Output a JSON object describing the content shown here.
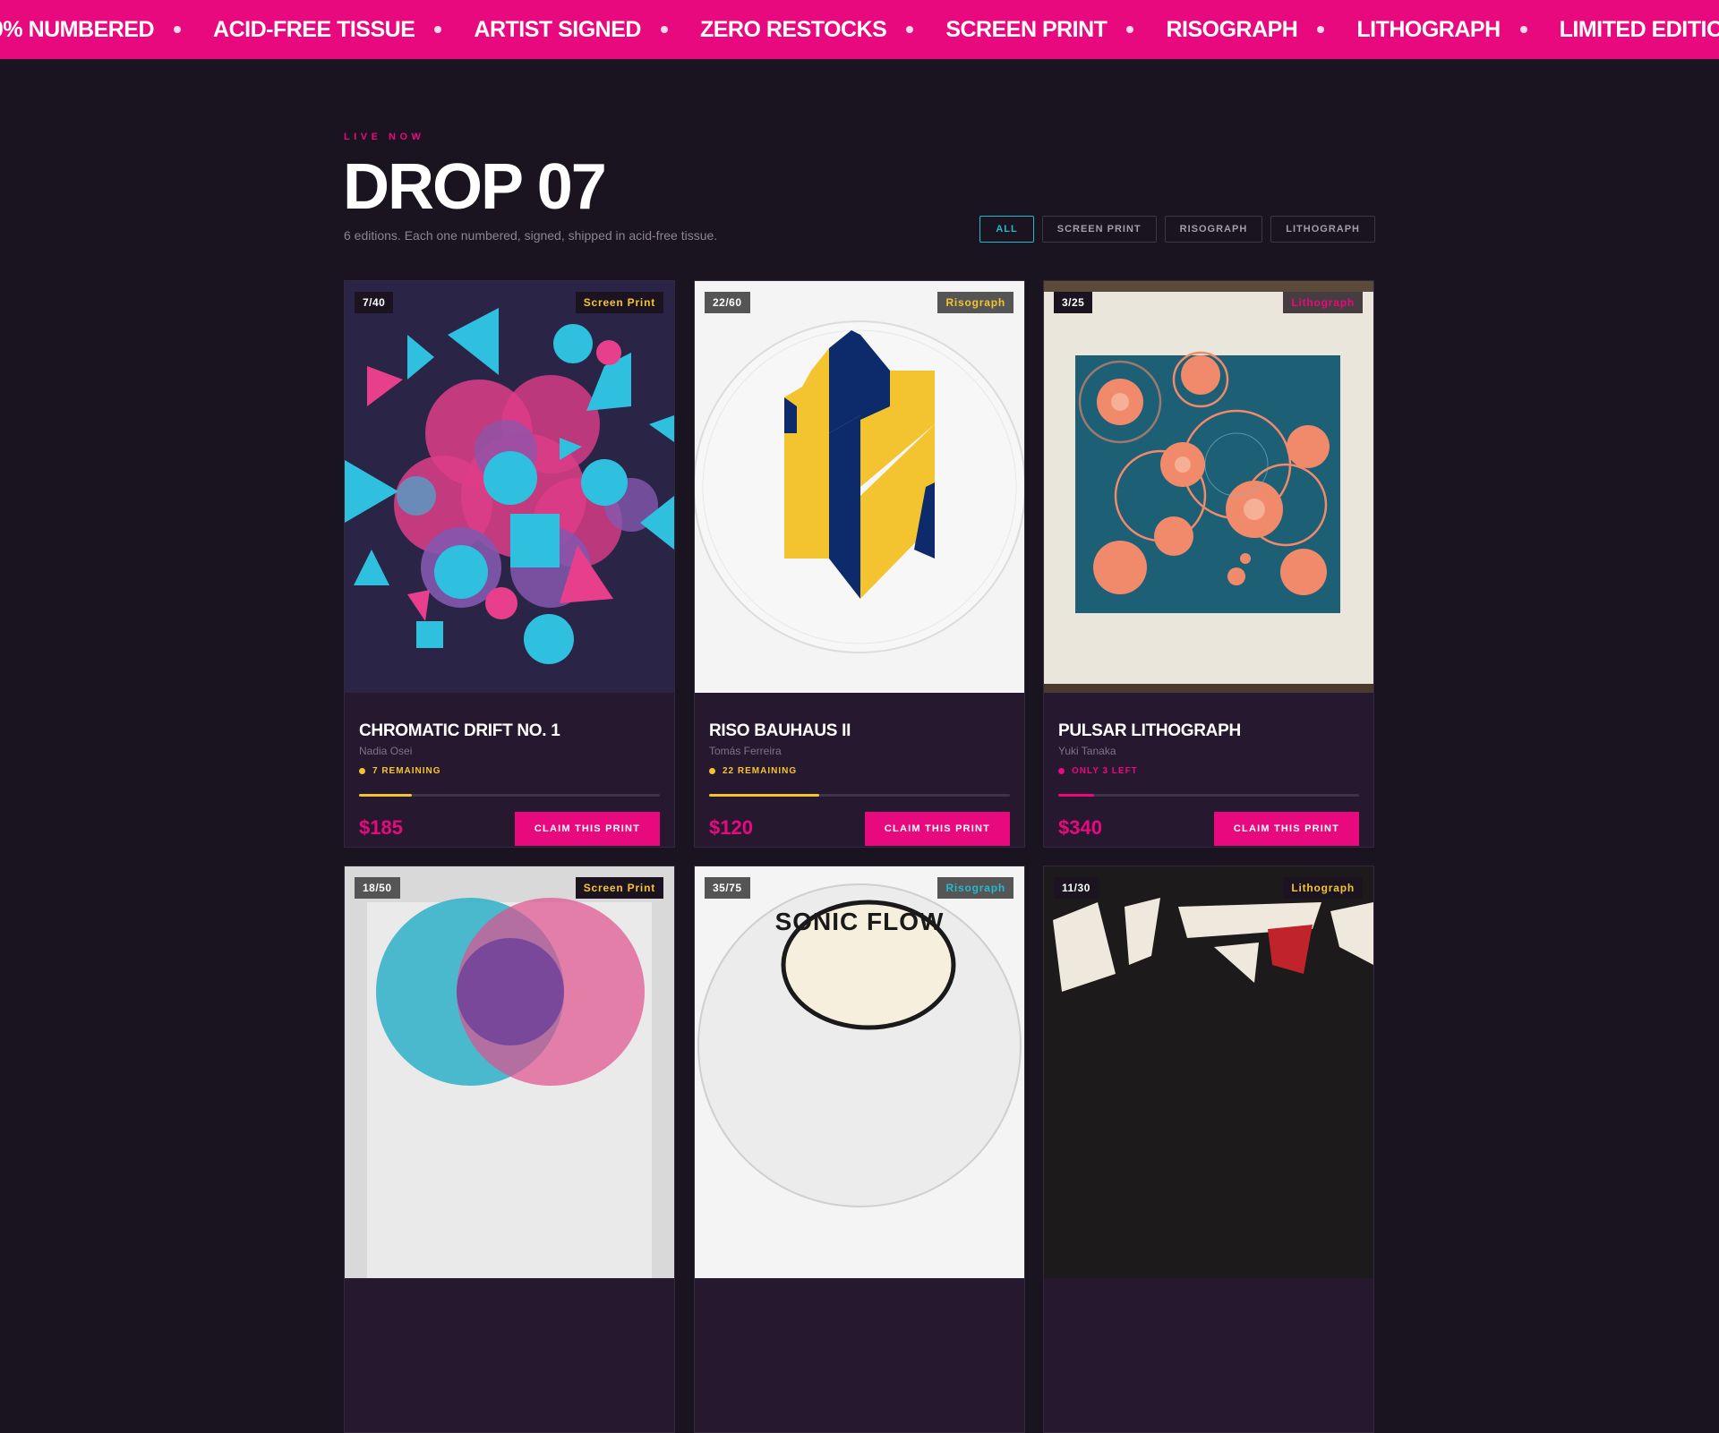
{
  "ticker": [
    "0% NUMBERED",
    "ACID-FREE TISSUE",
    "ARTIST SIGNED",
    "ZERO RESTOCKS",
    "SCREEN PRINT",
    "RISOGRAPH",
    "LITHOGRAPH",
    "LIMITED EDITION"
  ],
  "header": {
    "eyebrow": "LIVE NOW",
    "title": "DROP 07",
    "subtitle": "6 editions. Each one numbered, signed, shipped in acid-free tissue."
  },
  "filters": [
    "ALL",
    "SCREEN PRINT",
    "RISOGRAPH",
    "LITHOGRAPH"
  ],
  "active_filter": "ALL",
  "cards": [
    {
      "edition": "7/40",
      "type": "Screen Print",
      "title": "CHROMATIC DRIFT NO. 1",
      "artist": "Nadia Osei",
      "stock": "7 REMAINING",
      "remaining_fraction": 0.175,
      "stock_color": "#f4c430",
      "price": "$185",
      "cta": "CLAIM THIS PRINT"
    },
    {
      "edition": "22/60",
      "type": "Risograph",
      "title": "RISO BAUHAUS II",
      "artist": "Tomás Ferreira",
      "stock": "22 REMAINING",
      "remaining_fraction": 0.367,
      "stock_color": "#f4c430",
      "price": "$120",
      "cta": "CLAIM THIS PRINT"
    },
    {
      "edition": "3/25",
      "type": "Lithograph",
      "title": "PULSAR LITHOGRAPH",
      "artist": "Yuki Tanaka",
      "stock": "ONLY 3 LEFT",
      "remaining_fraction": 0.12,
      "stock_color": "#e8097f",
      "price": "$340",
      "cta": "CLAIM THIS PRINT"
    },
    {
      "edition": "18/50",
      "type": "Screen Print"
    },
    {
      "edition": "35/75",
      "type": "Risograph",
      "art_text": "SONIC FLOW"
    },
    {
      "edition": "11/30",
      "type": "Lithograph"
    }
  ],
  "colors": {
    "accent": "#e8097f",
    "cyan": "#25b9cf",
    "yellow": "#f4c430",
    "background": "#19141f"
  }
}
